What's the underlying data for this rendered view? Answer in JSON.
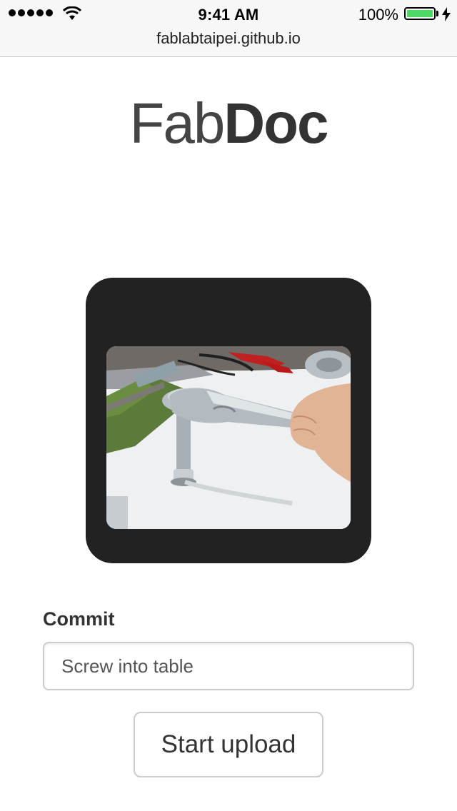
{
  "status_bar": {
    "time": "9:41 AM",
    "battery_percent": "100%",
    "signal_icon": "signal-dots-icon",
    "wifi_icon": "wifi-icon",
    "battery_icon": "battery-icon",
    "charging_icon": "bolt-icon"
  },
  "browser": {
    "url": "fablabtaipei.github.io"
  },
  "logo": {
    "light": "Fab",
    "bold": "Doc"
  },
  "preview": {
    "photo_description_icon": "photo-wrench-vise"
  },
  "form": {
    "commit_label": "Commit",
    "commit_value": "Screw into table",
    "upload_label": "Start upload"
  },
  "colors": {
    "preview_bg": "#222222",
    "battery": "#4cd964",
    "text": "#333333"
  }
}
